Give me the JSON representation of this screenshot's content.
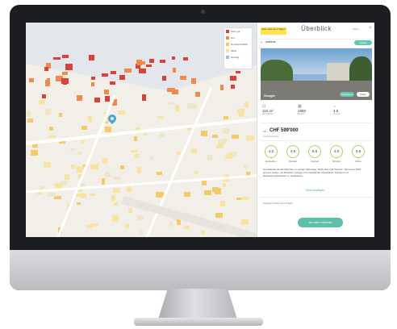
{
  "panel": {
    "tag": "Jetzt mehr zu 2 Tagen",
    "title": "Überblick",
    "link": "Teilen",
    "close": "×",
    "address": "address",
    "address_button": "Details anzeigen",
    "photo_google": "Google",
    "photo_btn1": "Streetview",
    "photo_btn2": "Karte",
    "facts": [
      {
        "icon": "area-icon",
        "value": "115 m²",
        "label": "Wohnfläche"
      },
      {
        "icon": "calendar-icon",
        "value": "1950",
        "label": "Baujahr"
      },
      {
        "icon": "rooms-icon",
        "value": "4.5",
        "label": "Zimmer"
      }
    ],
    "price_prefix": "ca.",
    "price": "CHF 599'000",
    "price_sub": "Angebotspreis",
    "scores": [
      {
        "value": "4.2",
        "label": "Einkaufen"
      },
      {
        "value": "4.5",
        "label": "Verkehr"
      },
      {
        "value": "5.0",
        "label": "Freizeit"
      },
      {
        "value": "4.0",
        "label": "Schulen"
      },
      {
        "value": "3.6",
        "label": "Ruhe"
      }
    ],
    "description": "Gemütliches Einfamilienhaus in ruhiger Wohnlage, Nähe See und Zentrum. Renoviert 2015, grosser Garten mit Sitzplatz, Garage und zusätzlicher Abstellplatz. Schulen und Einkaufsmöglichkeiten in Gehdistanz.",
    "more": "Mehr anzeigen",
    "online": "Angebot online seit 4 Tagen",
    "cta": "Ich habe Interesse"
  },
  "legend": [
    {
      "label": "Sehr gut",
      "color": "#d9423a"
    },
    {
      "label": "Gut",
      "color": "#f08a4b"
    },
    {
      "label": "Durchschnittlich",
      "color": "#f4c96a"
    },
    {
      "label": "Mittel",
      "color": "#f7e3a2"
    },
    {
      "label": "Günstig",
      "color": "#8ec8e8"
    }
  ],
  "colors": {
    "accent": "#5cbfa9",
    "tag": "#ffe24d",
    "pin": "#3fa7d6"
  }
}
